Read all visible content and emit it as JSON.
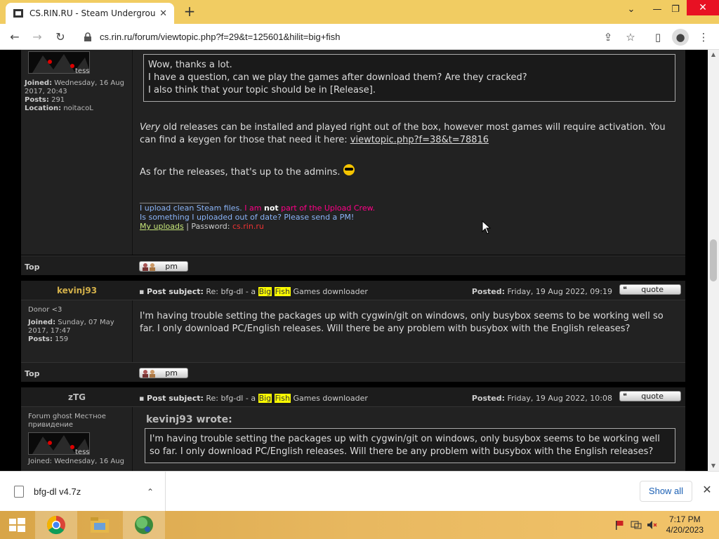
{
  "browser": {
    "tab_title": "CS.RIN.RU - Steam Underground",
    "tab_close": "✕",
    "new_tab": "+",
    "url": "cs.rin.ru/forum/viewtopic.php?f=29&t=125601&hilit=big+fish",
    "icons": [
      "back-icon",
      "forward-icon",
      "reload-icon",
      "lock-icon",
      "share-icon",
      "star-icon",
      "sidebar-icon",
      "profile-icon",
      "menu-icon"
    ]
  },
  "post1": {
    "joined_label": "Joined:",
    "joined_value": "Wednesday, 16 Aug 2017, 20:43",
    "posts_label": "Posts:",
    "posts_value": "291",
    "location_label": "Location:",
    "location_value": "noitacoL",
    "quote_lines": [
      "Wow, thanks a lot.",
      "I have a question, can we play the games after download them? Are they cracked?",
      "I also think that your topic should be in [Release]."
    ],
    "para1_em": "Very",
    "para1_rest": " old releases can be installed and played right out of the box, however most games will require activation. You can find a keygen for those that need it here: ",
    "para1_link": "viewtopic.php?f=38&t=78816",
    "para2": "As for the releases, that's up to the admins.",
    "sig_divider": "__________________",
    "sig_line1_a": "I upload clean Steam files.",
    "sig_line1_b": " I am ",
    "sig_line1_c": "not",
    "sig_line1_d": " part of the Upload Crew.",
    "sig_line2": "Is something I uploaded out of date? Please send a PM!",
    "sig_line3_link": "My uploads",
    "sig_line3_sep": " | Password: ",
    "sig_line3_pw": "cs.rin.ru",
    "top": "Top",
    "pm": "pm"
  },
  "post2": {
    "author": "kevinj93",
    "author_color": "#d4b14a",
    "rank": "Donor <3",
    "joined_label": "Joined:",
    "joined_value": "Sunday, 07 May 2017, 17:47",
    "posts_label": "Posts:",
    "posts_value": "159",
    "subject_label": "Post subject:",
    "subject_pre": "Re: bfg-dl - a ",
    "subject_hl1": "Big",
    "subject_hl2": "Fish",
    "subject_post": " Games downloader",
    "posted_label": "Posted:",
    "posted_value": "Friday, 19 Aug 2022, 09:19",
    "quote_btn": "quote",
    "body": "I'm having trouble setting the packages up with cygwin/git on windows, only busybox seems to be working well so far. I only download PC/English releases. Will there be any problem with busybox with the English releases?",
    "top": "Top",
    "pm": "pm"
  },
  "post3": {
    "author": "zTG",
    "author_color": "#bbbbbb",
    "rank": "Forum ghost Местное привидение",
    "joined_partial": "Joined: Wednesday, 16 Aug",
    "subject_label": "Post subject:",
    "subject_pre": "Re: bfg-dl - a ",
    "subject_hl1": "Big",
    "subject_hl2": "Fish",
    "subject_post": " Games downloader",
    "posted_label": "Posted:",
    "posted_value": "Friday, 19 Aug 2022, 10:08",
    "quote_btn": "quote",
    "wrote": "kevinj93 wrote:",
    "quote_text": "I'm having trouble setting the packages up with cygwin/git on windows, only busybox seems to be working well so far. I only download PC/English releases. Will there be any problem with busybox with the English releases?"
  },
  "downloads": {
    "file": "bfg-dl v4.7z",
    "show_all": "Show all",
    "close": "✕"
  },
  "taskbar": {
    "time": "7:17 PM",
    "date": "4/20/2023"
  }
}
